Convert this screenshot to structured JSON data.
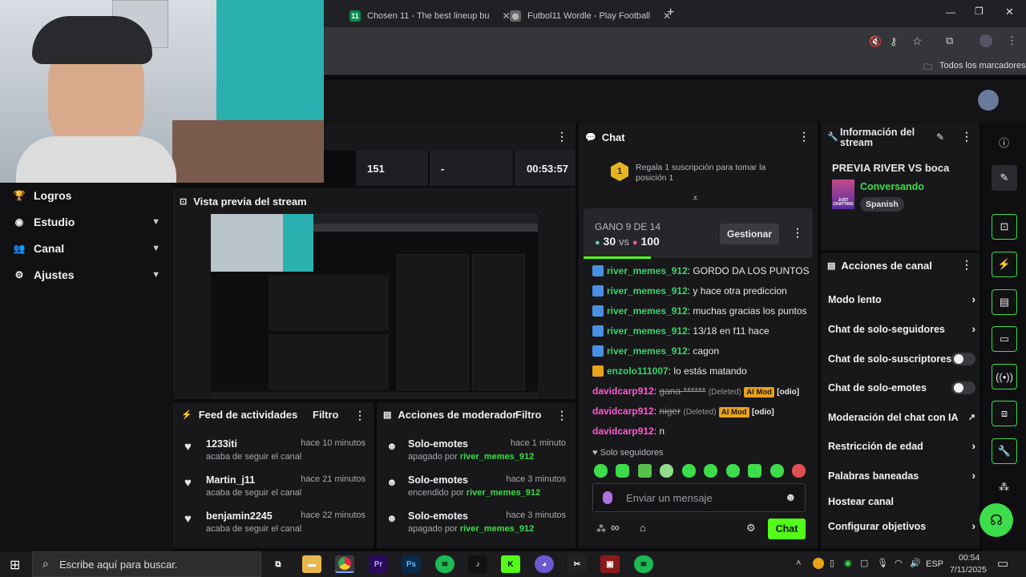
{
  "browser": {
    "tabs": [
      {
        "label": "Chosen 11 - The best lineup bu",
        "favicon": "chosen11-icon"
      },
      {
        "label": "Futbol11 Wordle - Play Football",
        "favicon": "futbol11-icon"
      }
    ],
    "new_tab": "+",
    "bookmarks_label": "Todos los marcadores"
  },
  "nav": {
    "items": [
      {
        "label": "Logros"
      },
      {
        "label": "Estudio"
      },
      {
        "label": "Canal"
      },
      {
        "label": "Ajustes"
      }
    ]
  },
  "stats": {
    "viewers": "151",
    "followers": "-",
    "uptime": "00:53:57"
  },
  "preview": {
    "title": "Vista previa del stream"
  },
  "activity": {
    "title": "Feed de actividades",
    "filter": "Filtro",
    "items": [
      {
        "user": "1233iti",
        "action": "acaba de seguir el canal",
        "time": "hace 10 minutos"
      },
      {
        "user": "Martin_j11",
        "action": "acaba de seguir el canal",
        "time": "hace 21 minutos"
      },
      {
        "user": "benjamin2245",
        "action": "acaba de seguir el canal",
        "time": "hace 22 minutos"
      }
    ]
  },
  "mod_actions": {
    "title": "Acciones de moderador",
    "filter": "Filtro",
    "items": [
      {
        "title": "Solo-emotes",
        "state": "apagado por",
        "by": "river_memes_912",
        "time": "hace 1 minuto"
      },
      {
        "title": "Solo-emotes",
        "state": "encendido por",
        "by": "river_memes_912",
        "time": "hace 3 minutos"
      },
      {
        "title": "Solo-emotes",
        "state": "apagado por",
        "by": "river_memes_912",
        "time": "hace 3 minutos"
      }
    ]
  },
  "chat": {
    "title": "Chat",
    "gift_rank": "1",
    "gift_text": "Regala 1 suscripción para tomar la posición 1",
    "prediction": {
      "label": "GANO 9 DE 14",
      "left_value": "30",
      "vs": "vs",
      "right_value": "100",
      "manage": "Gestionar"
    },
    "messages": [
      {
        "user": "river_memes_912",
        "text": ": GORDO DA LOS PUNTOS"
      },
      {
        "user": "river_memes_912",
        "text": ": y hace otra prediccion"
      },
      {
        "user": "river_memes_912",
        "text": ": muchas gracias los puntos"
      },
      {
        "user": "river_memes_912",
        "text": ": 13/18 en f11 hace"
      },
      {
        "user": "river_memes_912",
        "text": ": cagon"
      },
      {
        "user": "enzolo111007",
        "text": ": lo estás matando"
      }
    ],
    "deleted": [
      {
        "user": "davidcarp912",
        "text": "gana ******",
        "deleted": "(Deleted)",
        "tag": "AI Mod",
        "reason": "[odio]"
      },
      {
        "user": "davidcarp912",
        "text": "niger",
        "deleted": "(Deleted)",
        "tag": "AI Mod",
        "reason": "[odio]"
      }
    ],
    "last": {
      "user": "davidcarp912",
      "text": ": n"
    },
    "mode": "Solo seguidores",
    "placeholder": "Enviar un mensaje",
    "send": "Chat"
  },
  "stream_info": {
    "title": "Información del stream",
    "stream_title": "PREVIA RIVER VS boca",
    "category": "Conversando",
    "language": "Spanish",
    "thumb_label": "JUST CHATTING"
  },
  "channel_actions": {
    "title": "Acciones de canal",
    "items": [
      {
        "label": "Modo lento"
      },
      {
        "label": "Chat de solo-seguidores"
      },
      {
        "label": "Chat de solo-suscriptores"
      },
      {
        "label": "Chat de solo-emotes"
      },
      {
        "label": "Moderación del chat con IA"
      },
      {
        "label": "Restricción de edad"
      },
      {
        "label": "Palabras baneadas"
      },
      {
        "label": "Hostear canal"
      },
      {
        "label": "Configurar objetivos"
      }
    ]
  },
  "taskbar": {
    "search_placeholder": "Escribe aquí para buscar.",
    "lang": "ESP",
    "time": "00:54",
    "date": "7/11/2025"
  },
  "colors": {
    "accent_green": "#53fc18",
    "ai_mod": "#e8a21a",
    "username": "#38d46a"
  }
}
